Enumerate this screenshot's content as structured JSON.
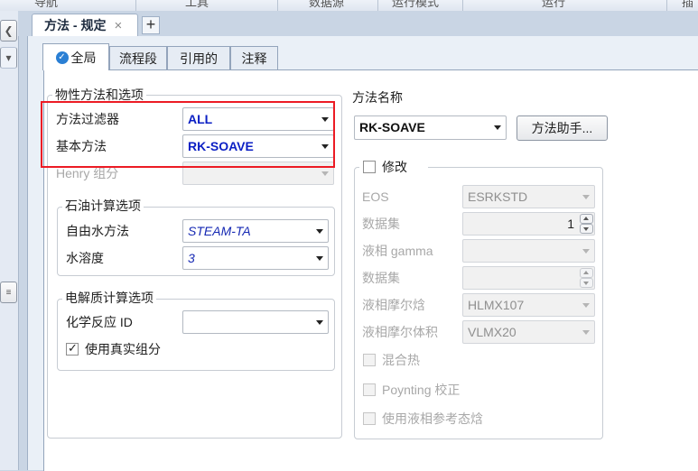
{
  "ribbon": {
    "items": [
      "导航",
      "工具",
      "数据源",
      "运行模式",
      "运行",
      "插"
    ]
  },
  "doc_tab": {
    "title": "方法 - 规定",
    "close": "×",
    "new_tab": "+"
  },
  "sub_tabs": [
    {
      "label": "全局",
      "active": true,
      "icon": "check-circle-icon"
    },
    {
      "label": "流程段"
    },
    {
      "label": "引用的"
    },
    {
      "label": "注释"
    }
  ],
  "left": {
    "group_title": "物性方法和选项",
    "filter_label": "方法过滤器",
    "filter_value": "ALL",
    "base_label": "基本方法",
    "base_value": "RK-SOAVE",
    "henry_label": "Henry 组分",
    "petroleum": {
      "title": "石油计算选项",
      "free_water_label": "自由水方法",
      "free_water_value": "STEAM-TA",
      "solubility_label": "水溶度",
      "solubility_value": "3"
    },
    "electrolyte": {
      "title": "电解质计算选项",
      "chem_label": "化学反应 ID",
      "chem_value": "",
      "true_comp_label": "使用真实组分",
      "true_comp_checked": true
    }
  },
  "right": {
    "method_name_label": "方法名称",
    "method_name_value": "RK-SOAVE",
    "helper_button": "方法助手...",
    "modify_label": "修改",
    "eos_label": "EOS",
    "eos_value": "ESRKSTD",
    "dataset_label": "数据集",
    "dataset_value": "1",
    "gamma_label": "液相 gamma",
    "dataset2_label": "数据集",
    "molar_enthalpy_label": "液相摩尔焓",
    "molar_enthalpy_value": "HLMX107",
    "molar_volume_label": "液相摩尔体积",
    "molar_volume_value": "VLMX20",
    "heat_mix_label": "混合热",
    "poynting_label": "Poynting 校正",
    "ref_state_label": "使用液相参考态焓"
  },
  "colors": {
    "highlight": "#ec1b24",
    "value_blue": "#0b1fc4"
  }
}
